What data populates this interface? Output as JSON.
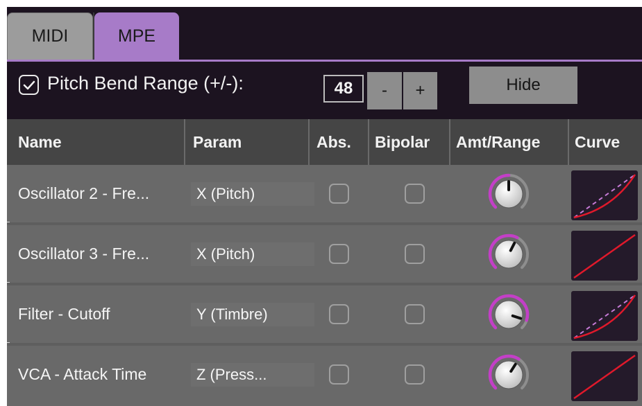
{
  "tabs": [
    {
      "label": "MIDI",
      "active": false
    },
    {
      "label": "MPE",
      "active": true
    }
  ],
  "pitch_bend": {
    "enabled": true,
    "label": "Pitch Bend Range (+/-):",
    "value": "48",
    "minus_label": "-",
    "plus_label": "+"
  },
  "hide_label": "Hide",
  "columns": [
    "Name",
    "Param",
    "Abs.",
    "Bipolar",
    "Amt/Range",
    "Curve"
  ],
  "rows": [
    {
      "name": "Oscillator 2 - Fre...",
      "param": "X (Pitch)",
      "abs": false,
      "bipolar": false,
      "knob_level": 0.5,
      "curve": "dual"
    },
    {
      "name": "Oscillator 3 - Fre...",
      "param": "X (Pitch)",
      "abs": false,
      "bipolar": false,
      "knob_level": 0.6,
      "curve": "linear"
    },
    {
      "name": "Filter - Cutoff",
      "param": "Y (Timbre)",
      "abs": false,
      "bipolar": false,
      "knob_level": 0.9,
      "curve": "dual"
    },
    {
      "name": "VCA - Attack Time",
      "param": "Z (Press...",
      "abs": false,
      "bipolar": false,
      "knob_level": 0.62,
      "curve": "linear"
    }
  ],
  "colors": {
    "accent": "#a77bc8",
    "knob_arc": "#c33fc7",
    "curve_line": "#e0192b",
    "curve_dash": "#c67ad6",
    "background": "#1c1320",
    "row": "#696969",
    "header": "#454545"
  }
}
